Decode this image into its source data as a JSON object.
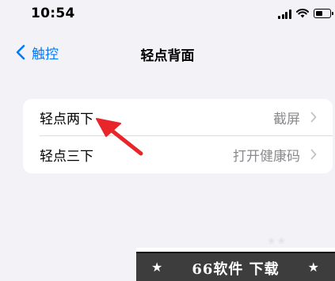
{
  "status_bar": {
    "time": "10:54",
    "icons": [
      "signal-icon",
      "wifi-icon",
      "battery-icon"
    ]
  },
  "nav": {
    "back_label": "触控",
    "title": "轻点背面"
  },
  "settings": {
    "rows": [
      {
        "label": "轻点两下",
        "value": "截屏"
      },
      {
        "label": "轻点三下",
        "value": "打开健康码"
      }
    ]
  },
  "annotation": {
    "color": "#e8262a",
    "icon": "red-arrow-icon"
  },
  "watermark": {
    "text": "66软件 下载",
    "star": "★"
  },
  "colors": {
    "accent": "#007aff",
    "background": "#f2f2f7",
    "secondary_text": "#8a8a8e"
  }
}
